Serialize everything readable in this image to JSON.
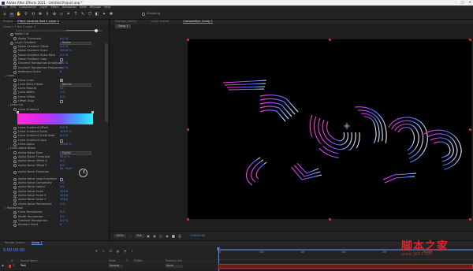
{
  "app": {
    "title": "Adobe After Effects 2021 - Untitled Project.aep *"
  },
  "menu": [
    "File",
    "Edit",
    "Composition",
    "Layer",
    "Effect",
    "Animation",
    "View",
    "Window",
    "Help"
  ],
  "toolbar": {
    "snapping_label": "Snapping"
  },
  "left_panel": {
    "tabs": [
      "Project",
      "Effect Controls Text 5 Layer 1"
    ],
    "path": "Comp 1 • Text 5 Layer 1",
    "rows": [
      {
        "t": "prop",
        "name": "Noise Cut",
        "indent": 2
      },
      {
        "t": "prop",
        "name": "Alpha Threshold",
        "val": "0.0 %",
        "indent": 3
      },
      {
        "t": "dd",
        "name": "Layer Gradient",
        "val": "Source",
        "indent": 2
      },
      {
        "t": "prop",
        "name": "Noise Gradient Offset",
        "val": "0.0 %",
        "indent": 3
      },
      {
        "t": "prop",
        "name": "Noise Gradient Scale",
        "val": "100.0 %",
        "indent": 3
      },
      {
        "t": "prop",
        "name": "Noise Gradient Scale Rate",
        "val": "0.0 %",
        "indent": 3
      },
      {
        "t": "chk",
        "name": "Noise Gradient Loop",
        "indent": 3
      },
      {
        "t": "prop",
        "name": "Gradient Randomise Amplitude",
        "val": "0.0 %",
        "indent": 3
      },
      {
        "t": "prop",
        "name": "Gradient Randomise Frequency",
        "val": "0.0 %",
        "indent": 3
      },
      {
        "t": "prop",
        "name": "Reflection Scale",
        "val": "0",
        "indent": 3
      },
      {
        "t": "group",
        "name": "Lines",
        "indent": 1
      },
      {
        "t": "chk",
        "name": "Draw Lines",
        "on": true,
        "indent": 3
      },
      {
        "t": "dd",
        "name": "Lines Blend Mode",
        "val": "Normal",
        "indent": 3
      },
      {
        "t": "prop",
        "name": "Lines Repeat",
        "val": "12",
        "indent": 3
      },
      {
        "t": "prop",
        "name": "Lines Width",
        "val": "1.0",
        "indent": 3
      },
      {
        "t": "prop",
        "name": "Lines Offset",
        "val": "0.0",
        "indent": 3
      },
      {
        "t": "chk",
        "name": "Offset Stop",
        "indent": 3
      },
      {
        "t": "group",
        "name": "Lines Col",
        "indent": 2
      },
      {
        "t": "prop",
        "name": "Lines Gradient",
        "indent": 3
      },
      {
        "t": "grad"
      },
      {
        "t": "prop",
        "name": "Lines Gradient Offset",
        "val": "0.0 %",
        "indent": 3
      },
      {
        "t": "prop",
        "name": "Lines Gradient Scale",
        "val": "100.0 %",
        "indent": 3
      },
      {
        "t": "prop",
        "name": "Lines Gradient Scale Rate",
        "val": "0.0 %",
        "indent": 3
      },
      {
        "t": "chk",
        "name": "Lines Gradient Loop",
        "indent": 3
      },
      {
        "t": "prop",
        "name": "Lines Alpha",
        "val": "100.0 %",
        "indent": 3
      },
      {
        "t": "group",
        "name": "Lines Alpha Noise",
        "indent": 2
      },
      {
        "t": "dd",
        "name": "Alpha Noise Type",
        "val": "Fractal",
        "indent": 3
      },
      {
        "t": "prop",
        "name": "Alpha Noise Threshold",
        "val": "50.0 %",
        "indent": 3
      },
      {
        "t": "prop",
        "name": "Alpha Noise Offset X",
        "val": "0.0",
        "indent": 3
      },
      {
        "t": "prop",
        "name": "Alpha Noise Offset Y",
        "val": "0.0",
        "indent": 3
      },
      {
        "t": "knob",
        "name": "Alpha Noise Evolution",
        "val": "0x +0.0°",
        "indent": 3
      },
      {
        "t": "chk",
        "name": "Alpha Noise Loop Evolution",
        "indent": 3
      },
      {
        "t": "prop",
        "name": "Alpha Noise Complexity",
        "val": "1.0",
        "indent": 3
      },
      {
        "t": "prop",
        "name": "Alpha Noise Speed",
        "val": "0.0",
        "indent": 3
      },
      {
        "t": "prop",
        "name": "Alpha Noise Scale",
        "val": "100.0",
        "indent": 3
      },
      {
        "t": "prop",
        "name": "Alpha Noise Scale X",
        "val": "100.0",
        "indent": 3
      },
      {
        "t": "prop",
        "name": "Alpha Noise Scale Y",
        "val": "100.0",
        "indent": 3
      },
      {
        "t": "prop",
        "name": "Alpha Noise Randomise",
        "val": "0.0",
        "indent": 3
      },
      {
        "t": "group",
        "name": "Randomise",
        "indent": 1
      },
      {
        "t": "prop",
        "name": "Lines Randomise",
        "val": "0.0",
        "indent": 3
      },
      {
        "t": "prop",
        "name": "Width Randomise",
        "val": "0.0",
        "indent": 3
      },
      {
        "t": "prop",
        "name": "Gradient Randomise",
        "val": "0.0 %",
        "indent": 3
      },
      {
        "t": "prop",
        "name": "Random Seed",
        "val": "0",
        "indent": 3
      }
    ]
  },
  "viewer": {
    "panels": [
      "Footage (none)",
      "Layer (none)",
      "Composition Comp 1"
    ],
    "comp_tab": "Comp 1",
    "zoom": "100%",
    "resolution": "Full",
    "timecode": "0:00:00:00"
  },
  "timeline": {
    "tabs": [
      "Render Queue",
      "Comp 1"
    ],
    "timecode": "0:00:00:00",
    "ticks": [
      "0f",
      "05f",
      "10f",
      "15f",
      "20f",
      "01:00f"
    ],
    "columns": [
      "#",
      "Source Name",
      "Mode",
      "T",
      "TrkMat",
      "Parent & Link"
    ],
    "layer": {
      "index": "1",
      "name": "Text",
      "mode": "Normal",
      "parent": "None"
    }
  },
  "watermark": {
    "big": "脚本之家",
    "small": "www.jb51.net"
  },
  "colors": {
    "accent": "#4c8dff",
    "label_red": "#d63b3b",
    "grad_start": "#ff2ad8",
    "grad_end": "#2ff0ff"
  }
}
